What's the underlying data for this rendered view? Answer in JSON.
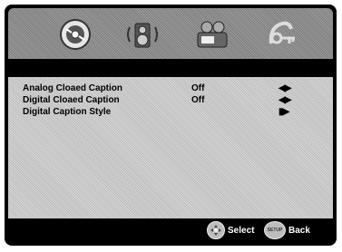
{
  "tabs": [
    {
      "name": "general-setup",
      "icon": "disc-icon"
    },
    {
      "name": "audio-setup",
      "icon": "speaker-icon"
    },
    {
      "name": "video-setup",
      "icon": "video-icon"
    },
    {
      "name": "preference",
      "icon": "preference-icon"
    }
  ],
  "menu": {
    "rows": [
      {
        "label": "Analog Cloaed Caption",
        "value": "Off",
        "arrows": "◀▶"
      },
      {
        "label": "Digital Cloaed Caption",
        "value": "Off",
        "arrows": "◀▶"
      },
      {
        "label": "Digital Caption Style",
        "value": "",
        "arrows": "▮▶"
      }
    ]
  },
  "footer": {
    "select_label": "Select",
    "back_label": "Back",
    "setup_button_text": "SETUP"
  }
}
